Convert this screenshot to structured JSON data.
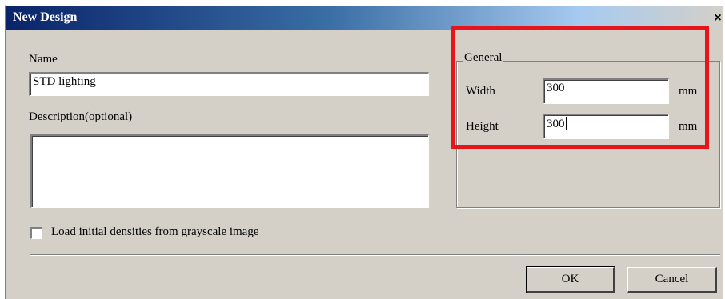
{
  "window": {
    "title": "New Design",
    "close_glyph": "×"
  },
  "form": {
    "name_label": "Name",
    "name_value": "STD lighting",
    "description_label": "Description(optional)",
    "description_value": "",
    "checkbox_label": "Load initial densities from grayscale image",
    "checkbox_checked": false
  },
  "general": {
    "legend": "General",
    "width_label": "Width",
    "width_value": "300",
    "width_unit": "mm",
    "height_label": "Height",
    "height_value": "300",
    "height_unit": "mm"
  },
  "buttons": {
    "ok": "OK",
    "cancel": "Cancel"
  },
  "colors": {
    "highlight": "#e8141b",
    "titlebar_start": "#0a246a",
    "dialog_bg": "#d4d0c8"
  }
}
